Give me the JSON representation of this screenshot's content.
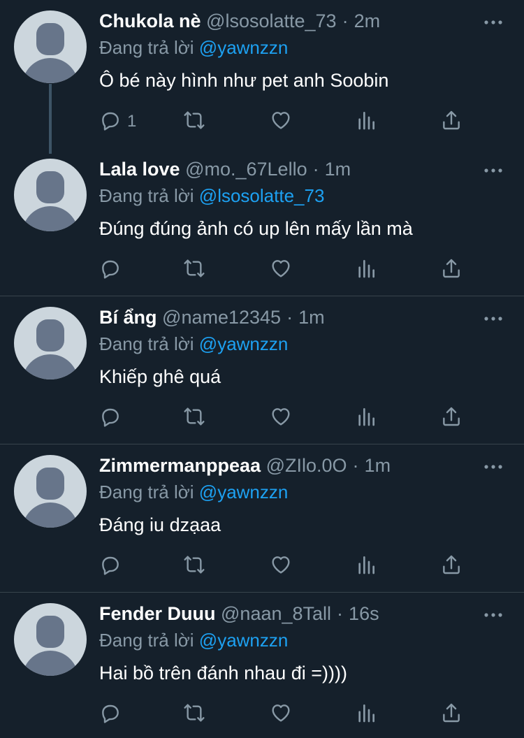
{
  "tweets": [
    {
      "name": "Chukola nè",
      "handle": "@lsosolatte_73",
      "time": "2m",
      "reply_prefix": "Đang trả lời",
      "reply_to": "@yawnzzn",
      "text": "Ô bé này hình như pet anh Soobin",
      "reply_count": "1"
    },
    {
      "name": "Lala love",
      "handle": "@mo._67Lello",
      "time": "1m",
      "reply_prefix": "Đang trả lời",
      "reply_to": "@lsosolatte_73",
      "text": "Đúng đúng ảnh có up lên mấy lần mà",
      "reply_count": ""
    },
    {
      "name": "Bí ẩng",
      "handle": "@name12345",
      "time": "1m",
      "reply_prefix": "Đang trả lời",
      "reply_to": "@yawnzzn",
      "text": "Khiếp ghê quá",
      "reply_count": ""
    },
    {
      "name": "Zimmermanppeaa",
      "handle": "@ZIlo.0O",
      "time": "1m",
      "reply_prefix": "Đang trả lời",
      "reply_to": "@yawnzzn",
      "text": "Đáng iu dzạaa",
      "reply_count": ""
    },
    {
      "name": "Fender Duuu",
      "handle": "@naan_8Tall",
      "time": "16s",
      "reply_prefix": "Đang trả lời",
      "reply_to": "@yawnzzn",
      "text": "Hai bồ trên đánh nhau đi =))))",
      "reply_count": ""
    }
  ],
  "separator": "·",
  "colors": {
    "background": "#15202b",
    "secondary_text": "#8899a6",
    "link": "#1da1f2",
    "divider": "#38444d",
    "icon": "#8899a6"
  },
  "icons": [
    "reply-icon",
    "retweet-icon",
    "like-icon",
    "analytics-icon",
    "share-icon",
    "more-icon"
  ]
}
